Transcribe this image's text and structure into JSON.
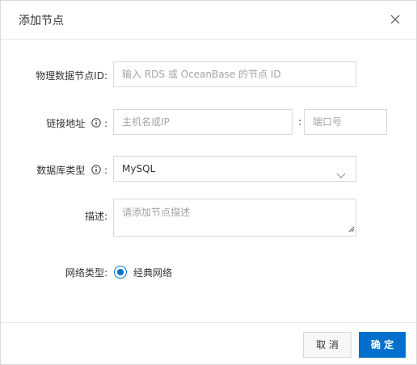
{
  "dialog": {
    "title": "添加节点",
    "close_icon": "close-icon"
  },
  "form": {
    "node_id": {
      "label": "物理数据节点ID:",
      "placeholder": "输入 RDS 或 OceanBase 的节点 ID"
    },
    "link_address": {
      "label": "链接地址",
      "label_suffix": ":",
      "host_placeholder": "主机名或IP",
      "separator": ":",
      "port_placeholder": "端口号",
      "info_icon": "info-icon"
    },
    "db_type": {
      "label": "数据库类型",
      "label_suffix": ":",
      "selected": "MySQL",
      "info_icon": "info-icon",
      "dropdown_icon": "chevron-down-icon"
    },
    "description": {
      "label": "描述:",
      "placeholder": "请添加节点描述"
    },
    "network_type": {
      "label": "网络类型:",
      "option_label": "经典网络",
      "selected": true
    }
  },
  "footer": {
    "cancel_label": "取 消",
    "ok_label": "确 定"
  },
  "colors": {
    "primary": "#0070cc",
    "border": "#d9d9d9",
    "placeholder": "#a3a3a3",
    "text": "#333333"
  }
}
